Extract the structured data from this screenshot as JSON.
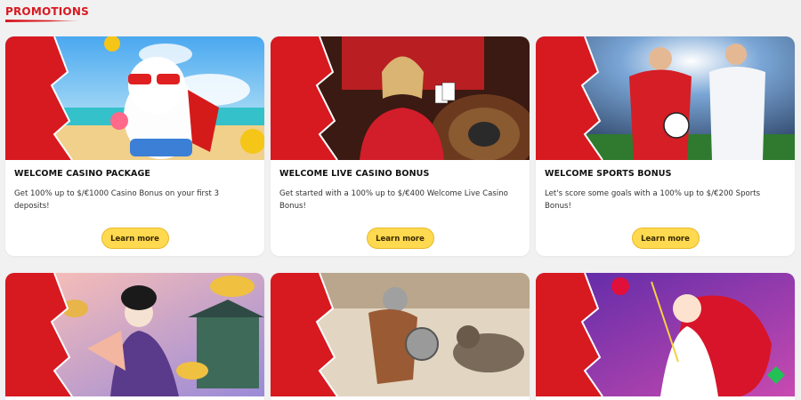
{
  "header": {
    "title": "PROMOTIONS"
  },
  "cards": [
    {
      "title": "WELCOME CASINO PACKAGE",
      "description": "Get 100% up to $/€1000 Casino Bonus on your first 3 deposits!",
      "button": "Learn more"
    },
    {
      "title": "WELCOME LIVE CASINO BONUS",
      "description": "Get started with a 100% up to $/€400 Welcome Live Casino Bonus!",
      "button": "Learn more"
    },
    {
      "title": "WELCOME SPORTS BONUS",
      "description": "Let's score some goals with a 100% up to $/€200 Sports Bonus!",
      "button": "Learn more"
    }
  ],
  "colors": {
    "brand_red": "#d71920",
    "button_yellow": "#ffd94f",
    "page_bg": "#f1f1f1"
  }
}
